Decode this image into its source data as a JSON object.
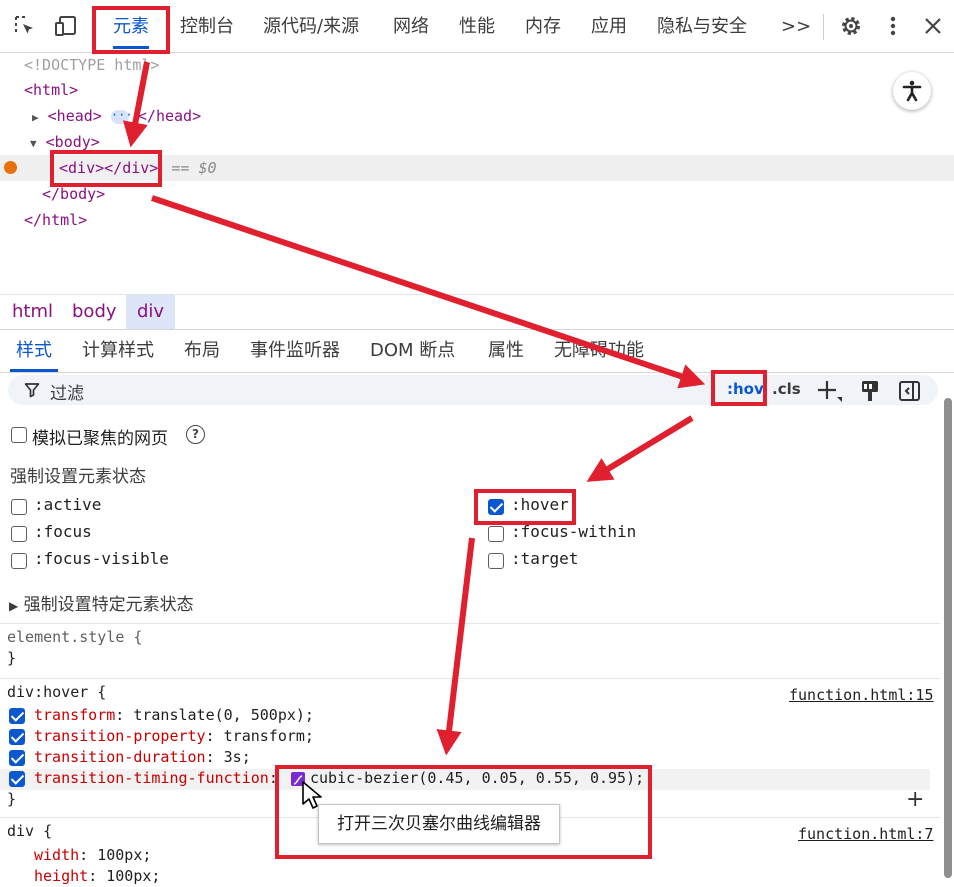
{
  "toolbar": {
    "tabs": [
      "元素",
      "控制台",
      "源代码/来源",
      "网络",
      "性能",
      "内存",
      "应用",
      "隐私与安全"
    ],
    "more": ">>"
  },
  "dom": {
    "doctype": "<!DOCTYPE html>",
    "html_open": "<html>",
    "head_open": "<head>",
    "head_ellipsis": "···",
    "head_close": "</head>",
    "body_open": "<body>",
    "div_node": "<div></div>",
    "eq": "== $0",
    "body_close": "</body>",
    "html_close": "</html>"
  },
  "breadcrumbs": [
    "html",
    "body",
    "div"
  ],
  "subtabs": [
    "样式",
    "计算样式",
    "布局",
    "事件监听器",
    "DOM 断点",
    "属性",
    "无障碍功能"
  ],
  "filter": {
    "label": "过滤",
    "hov": ":hov",
    "cls": ".cls"
  },
  "states": {
    "emulate_focus": "模拟已聚焦的网页",
    "force_title": "强制设置元素状态",
    "items": [
      ":active",
      ":focus",
      ":focus-visible",
      ":hover",
      ":focus-within",
      ":target"
    ],
    "checked": [
      false,
      false,
      false,
      true,
      false,
      false
    ],
    "specific": "强制设置特定元素状态"
  },
  "rules": {
    "element_style": {
      "selector": "element.style {",
      "close": "}"
    },
    "hover": {
      "selector": "div:hover {",
      "source": "function.html:15",
      "props": [
        {
          "name": "transform",
          "value": "translate(0, 500px);"
        },
        {
          "name": "transition-property",
          "value": "transform;"
        },
        {
          "name": "transition-duration",
          "value": "3s;"
        },
        {
          "name": "transition-timing-function",
          "value": "cubic-bezier(0.45, 0.05, 0.55, 0.95);"
        }
      ],
      "close": "}"
    },
    "div": {
      "selector": "div {",
      "source": "function.html:7",
      "props": [
        {
          "name": "width",
          "value": "100px;"
        },
        {
          "name": "height",
          "value": "100px;"
        }
      ]
    }
  },
  "tooltip": "打开三次贝塞尔曲线编辑器",
  "colors": {
    "accent": "#0b57d0",
    "annotation": "#e0202e",
    "tag": "#881280",
    "prop": "#c80000"
  }
}
